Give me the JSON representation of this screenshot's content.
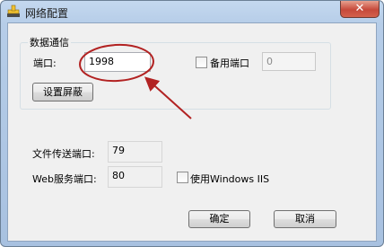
{
  "window": {
    "title": "网络配置",
    "close_glyph": "✕"
  },
  "data_comm": {
    "group_label": "数据通信",
    "port_label": "端口:",
    "port_value": "1998",
    "backup_port_label": "备用端口",
    "backup_port_value": "0",
    "backup_port_checked": false,
    "shield_button_label": "设置屏蔽"
  },
  "file_transfer": {
    "port_label": "文件传送端口:",
    "port_value": "79"
  },
  "web_service": {
    "port_label": "Web服务端口:",
    "port_value": "80",
    "iis_label": "使用Windows IIS",
    "iis_checked": false
  },
  "actions": {
    "ok_label": "确定",
    "cancel_label": "取消"
  },
  "annotation": {
    "color": "#b22222"
  }
}
